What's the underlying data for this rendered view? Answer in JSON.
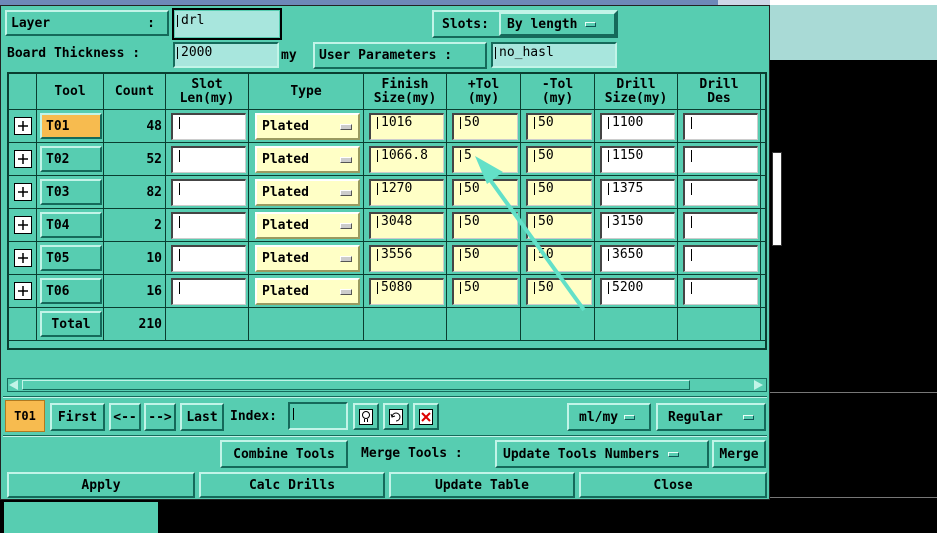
{
  "layer": {
    "label": "Layer",
    "colon": ":",
    "value": "drl"
  },
  "slots": {
    "label": "Slots:",
    "value": "By length"
  },
  "board": {
    "label": "Board Thickness :",
    "value": "2000",
    "unit": "my"
  },
  "user_params": {
    "label": "User Parameters :",
    "value": "no_hasl"
  },
  "table": {
    "headers": [
      "Tool",
      "Count",
      "Slot\nLen(my)",
      "Type",
      "Finish\nSize(my)",
      "+Tol\n(my)",
      "-Tol\n(my)",
      "Drill\nSize(my)",
      "Drill\nDes"
    ],
    "rows": [
      {
        "tool": "T01",
        "count": "48",
        "slot": "",
        "type": "Plated",
        "finish": "1016",
        "ptol": "50",
        "mtol": "50",
        "drill": "1100",
        "des": ""
      },
      {
        "tool": "T02",
        "count": "52",
        "slot": "",
        "type": "Plated",
        "finish": "1066.8",
        "ptol": "5",
        "mtol": "50",
        "drill": "1150",
        "des": ""
      },
      {
        "tool": "T03",
        "count": "82",
        "slot": "",
        "type": "Plated",
        "finish": "1270",
        "ptol": "50",
        "mtol": "50",
        "drill": "1375",
        "des": ""
      },
      {
        "tool": "T04",
        "count": "2",
        "slot": "",
        "type": "Plated",
        "finish": "3048",
        "ptol": "50",
        "mtol": "50",
        "drill": "3150",
        "des": ""
      },
      {
        "tool": "T05",
        "count": "10",
        "slot": "",
        "type": "Plated",
        "finish": "3556",
        "ptol": "50",
        "mtol": "50",
        "drill": "3650",
        "des": ""
      },
      {
        "tool": "T06",
        "count": "16",
        "slot": "",
        "type": "Plated",
        "finish": "5080",
        "ptol": "50",
        "mtol": "50",
        "drill": "5200",
        "des": ""
      }
    ],
    "total_label": "Total",
    "total_count": "210"
  },
  "nav": {
    "current": "T01",
    "first": "First",
    "prev": "<--",
    "next": "-->",
    "last": "Last",
    "index_label": "Index:",
    "units": "ml/my",
    "mode": "Regular"
  },
  "actions": {
    "combine": "Combine Tools",
    "merge_label": "Merge Tools :",
    "update_numbers": "Update Tools Numbers",
    "merge": "Merge"
  },
  "bottom": {
    "apply": "Apply",
    "calc": "Calc Drills",
    "update": "Update Table",
    "close": "Close"
  },
  "colors": {
    "panel": "#57cdb1",
    "selected_tool": "#f7bb4f",
    "yellow_field": "#ffffc6",
    "arrow": "#63e0c8"
  }
}
